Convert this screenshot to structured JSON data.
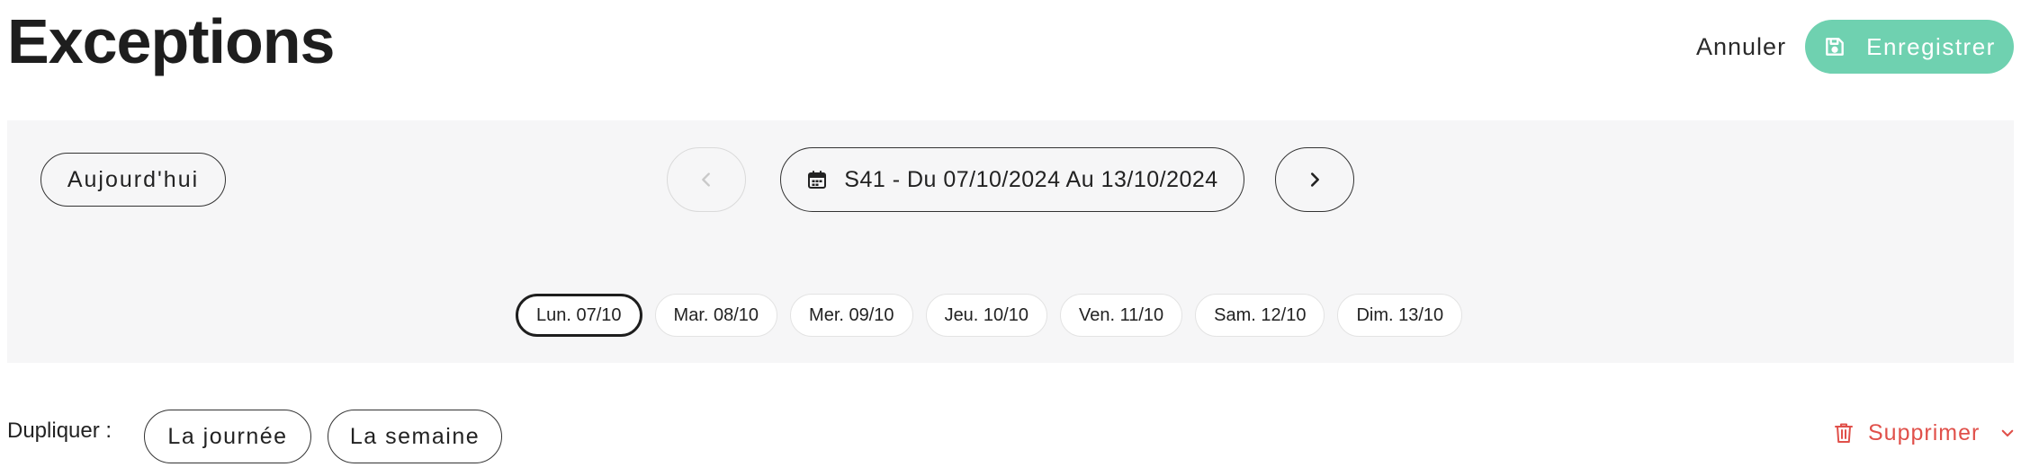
{
  "header": {
    "title": "Exceptions",
    "cancel_label": "Annuler",
    "save_label": "Enregistrer"
  },
  "nav": {
    "today_label": "Aujourd'hui",
    "week_label": "S41 - Du 07/10/2024 Au 13/10/2024",
    "prev_icon": "chevron-left-icon",
    "next_icon": "chevron-right-icon",
    "calendar_icon": "calendar-icon"
  },
  "days": [
    {
      "label": "Lun. 07/10",
      "active": true
    },
    {
      "label": "Mar. 08/10",
      "active": false
    },
    {
      "label": "Mer. 09/10",
      "active": false
    },
    {
      "label": "Jeu. 10/10",
      "active": false
    },
    {
      "label": "Ven. 11/10",
      "active": false
    },
    {
      "label": "Sam. 12/10",
      "active": false
    },
    {
      "label": "Dim. 13/10",
      "active": false
    }
  ],
  "duplicate": {
    "label": "Dupliquer :",
    "day_label": "La journée",
    "week_label": "La semaine"
  },
  "delete": {
    "label": "Supprimer"
  },
  "colors": {
    "accent": "#6fd1b0",
    "danger": "#e0504a",
    "panel": "#f6f6f7"
  }
}
